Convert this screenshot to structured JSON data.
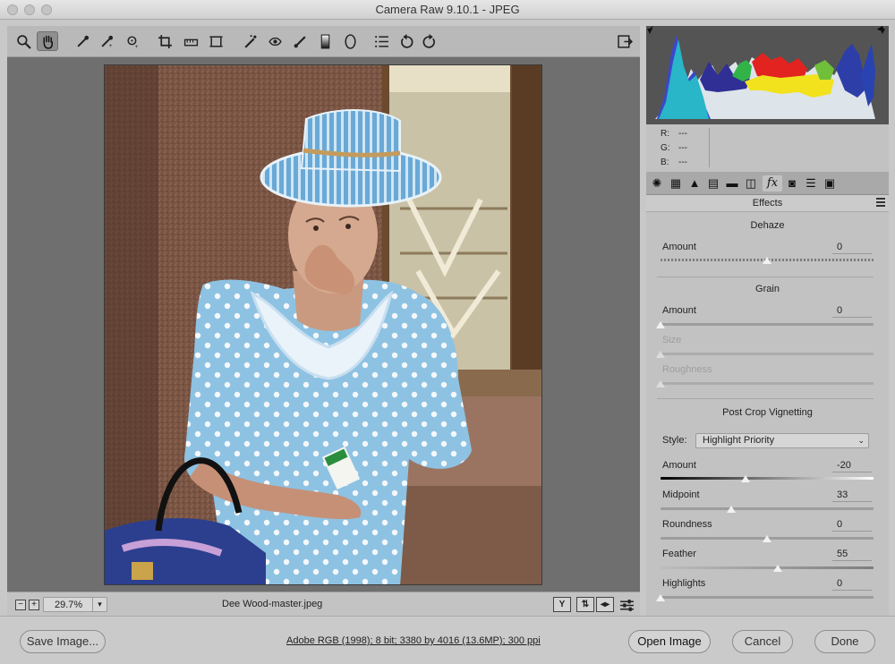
{
  "window": {
    "title": "Camera Raw 9.10.1  -  JPEG"
  },
  "toolbar": {
    "tools": [
      {
        "name": "zoom-tool",
        "glyph": "🔍"
      },
      {
        "name": "hand-tool",
        "glyph": "✋"
      },
      {
        "name": "white-balance-tool",
        "glyph": "⁄"
      },
      {
        "name": "color-sampler-tool",
        "glyph": "⁄"
      },
      {
        "name": "targeted-adjustment-tool",
        "glyph": "⊚"
      },
      {
        "name": "crop-tool",
        "glyph": "⌗"
      },
      {
        "name": "straighten-tool",
        "glyph": "▭"
      },
      {
        "name": "transform-tool",
        "glyph": "⊡"
      },
      {
        "name": "spot-removal-tool",
        "glyph": "⁄"
      },
      {
        "name": "red-eye-tool",
        "glyph": "◉"
      },
      {
        "name": "adjustment-brush-tool",
        "glyph": "⁄"
      },
      {
        "name": "graduated-filter-tool",
        "glyph": "▮"
      },
      {
        "name": "radial-filter-tool",
        "glyph": "◯"
      },
      {
        "name": "preferences-tool",
        "glyph": "☰"
      },
      {
        "name": "rotate-left-tool",
        "glyph": "↺"
      },
      {
        "name": "rotate-right-tool",
        "glyph": "↻"
      }
    ],
    "active_tool": "hand-tool"
  },
  "readout": {
    "r_label": "R:",
    "r_value": "---",
    "g_label": "G:",
    "g_value": "---",
    "b_label": "B:",
    "b_value": "---"
  },
  "panel": {
    "title": "Effects",
    "tabs": [
      "basic",
      "tone-curve",
      "detail",
      "hsl",
      "split-toning",
      "lens-corrections",
      "effects",
      "camera-calibration",
      "presets",
      "snapshots"
    ],
    "active_tab_glyph": "fx",
    "dehaze": {
      "title": "Dehaze",
      "amount_label": "Amount",
      "amount_value": "0",
      "amount_level": 0.5
    },
    "grain": {
      "title": "Grain",
      "amount_label": "Amount",
      "amount_value": "0",
      "amount_level": 0.0,
      "size_label": "Size",
      "size_level": 0.0,
      "roughness_label": "Roughness",
      "roughness_level": 0.0
    },
    "vignetting": {
      "title": "Post Crop Vignetting",
      "style_label": "Style:",
      "style_value": "Highlight Priority",
      "amount_label": "Amount",
      "amount_value": "-20",
      "amount_level": 0.4,
      "midpoint_label": "Midpoint",
      "midpoint_value": "33",
      "midpoint_level": 0.33,
      "roundness_label": "Roundness",
      "roundness_value": "0",
      "roundness_level": 0.5,
      "feather_label": "Feather",
      "feather_value": "55",
      "feather_level": 0.55,
      "highlights_label": "Highlights",
      "highlights_value": "0",
      "highlights_level": 0.0
    }
  },
  "status": {
    "zoom_minus": "−",
    "zoom_plus": "+",
    "zoom_value": "29.7%",
    "filename": "Dee Wood-master.jpeg",
    "view_y": "Y"
  },
  "footer": {
    "save_label": "Save Image...",
    "info_text": "Adobe RGB (1998); 8 bit; 3380 by 4016 (13.6MP); 300 ppi",
    "open_label": "Open Image",
    "cancel_label": "Cancel",
    "done_label": "Done"
  }
}
